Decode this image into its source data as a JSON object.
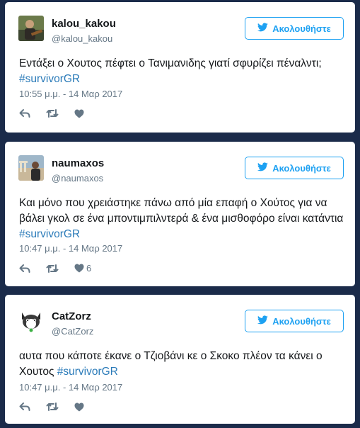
{
  "colors": {
    "background": "#1b2b4a",
    "card": "#ffffff",
    "accent": "#1da1f2",
    "hashtag": "#2b7bb9",
    "secondary_text": "#657786"
  },
  "follow_label": "Ακολουθήστε",
  "tweets": [
    {
      "name": "kalou_kakou",
      "handle": "@kalou_kakou",
      "text": "Εντάξει ο Χουτος πέφτει ο Τανιμανιδης γιατί σφυρίζει πέναλντι;",
      "hashtag": "#survivorGR",
      "timestamp": "10:55 μ.μ. - 14 Μαρ 2017",
      "likes": ""
    },
    {
      "name": "naumaxos",
      "handle": "@naumaxos",
      "text": "Και μόνο που χρειάστηκε πάνω από μία επαφή ο Χούτος για να βάλει γκολ σε ένα μποντιμπιλντερά & ένα μισθοφόρο είναι κατάντια",
      "hashtag": "#survivorGR",
      "timestamp": "10:47 μ.μ. - 14 Μαρ 2017",
      "likes": "6"
    },
    {
      "name": "CatZorz",
      "handle": "@CatZorz",
      "text": "αυτα που κάποτε έκανε ο Τζιοβάνι κε ο Σκοκο πλέον τα κάνει ο Χουτος",
      "hashtag": "#survivorGR",
      "timestamp": "10:47 μ.μ. - 14 Μαρ 2017",
      "likes": ""
    }
  ]
}
